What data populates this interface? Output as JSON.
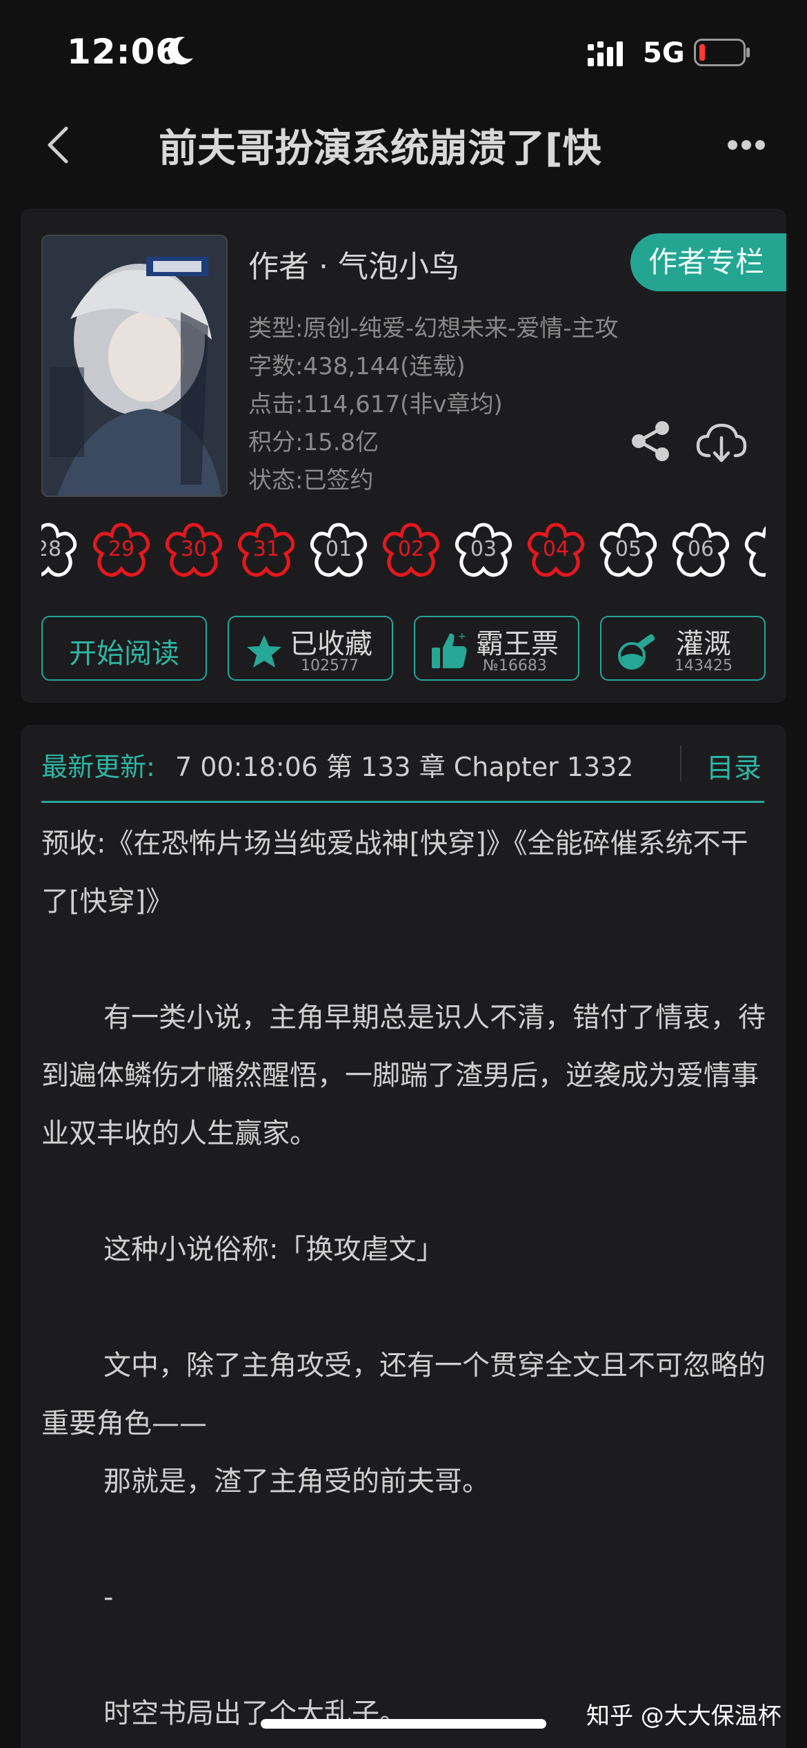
{
  "status_bar": {
    "time": "12:06",
    "network": "5G",
    "battery_color": "#ff3b30"
  },
  "nav": {
    "title": "前夫哥扮演系统崩溃了[快",
    "back_icon": "chevron-left-icon",
    "more_icon": "more-dots-icon"
  },
  "book": {
    "author_line": "作者 · 气泡小鸟",
    "author_column_button": "作者专栏",
    "meta": [
      "类型:原创-纯爱-幻想未来-爱情-主攻",
      "字数:438,144(连载)",
      "点击:114,617(非v章均)",
      "积分:15.8亿",
      "状态:已签约"
    ],
    "flowers": [
      {
        "label": "28",
        "color": "#ffffff"
      },
      {
        "label": "29",
        "color": "#e3181e"
      },
      {
        "label": "30",
        "color": "#e3181e"
      },
      {
        "label": "31",
        "color": "#e3181e"
      },
      {
        "label": "01",
        "color": "#ffffff"
      },
      {
        "label": "02",
        "color": "#e3181e"
      },
      {
        "label": "03",
        "color": "#ffffff"
      },
      {
        "label": "04",
        "color": "#e3181e"
      },
      {
        "label": "05",
        "color": "#ffffff"
      },
      {
        "label": "06",
        "color": "#ffffff"
      }
    ],
    "actions": {
      "start_reading": "开始阅读",
      "collected": "已收藏",
      "collected_count": "102577",
      "bawang": "霸王票",
      "bawang_count": "№16683",
      "guangai": "灌溉",
      "guangai_count": "143425"
    }
  },
  "content": {
    "latest_label": "最新更新:",
    "latest_text": "7 00:18:06   第 133 章 Chapter 1332",
    "toc": "目录",
    "paragraphs": [
      "预收:《在恐怖片场当纯爱战神[快穿]》《全能碎催系统不干了[快穿]》",
      "有一类小说，主角早期总是识人不清，错付了情衷，待到遍体鳞伤才幡然醒悟，一脚踹了渣男后，逆袭成为爱情事业双丰收的人生赢家。",
      "这种小说俗称:「换攻虐文」",
      "文中，除了主角攻受，还有一个贯穿全文且不可忽略的重要角色——",
      "那就是，渣了主角受的前夫哥。",
      "-",
      "时空书局出了个大乱子。"
    ]
  },
  "watermark": "知乎 @大大保温杯",
  "accent_color": "#27a796"
}
